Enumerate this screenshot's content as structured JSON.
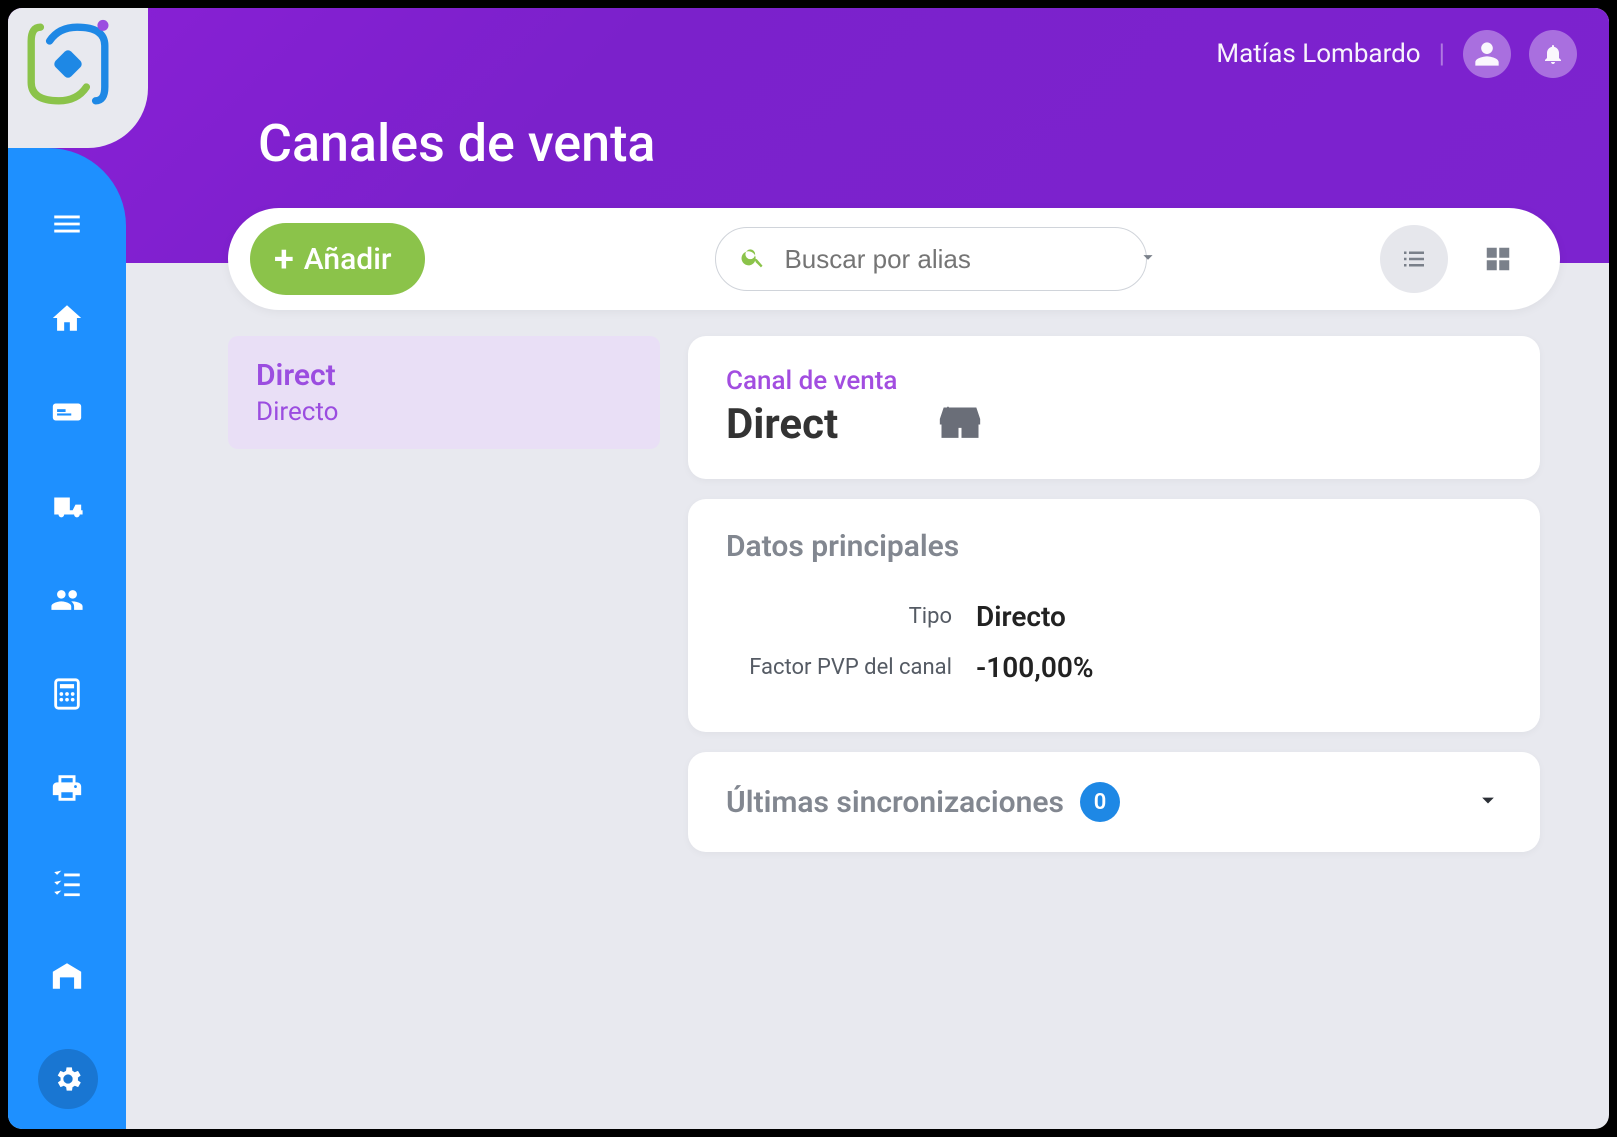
{
  "header": {
    "page_title": "Canales de venta",
    "user_name": "Matías Lombardo"
  },
  "toolbar": {
    "add_label": "Añadir",
    "search_placeholder": "Buscar por alias"
  },
  "list": {
    "items": [
      {
        "title": "Direct",
        "subtitle": "Directo"
      }
    ]
  },
  "detail": {
    "section_label": "Canal de venta",
    "name": "Direct",
    "main_data_title": "Datos principales",
    "fields": {
      "type_label": "Tipo",
      "type_value": "Directo",
      "pvp_label": "Factor PVP del canal",
      "pvp_value": "-100,00%"
    },
    "sync_title": "Últimas sincronizaciones",
    "sync_count": "0"
  }
}
